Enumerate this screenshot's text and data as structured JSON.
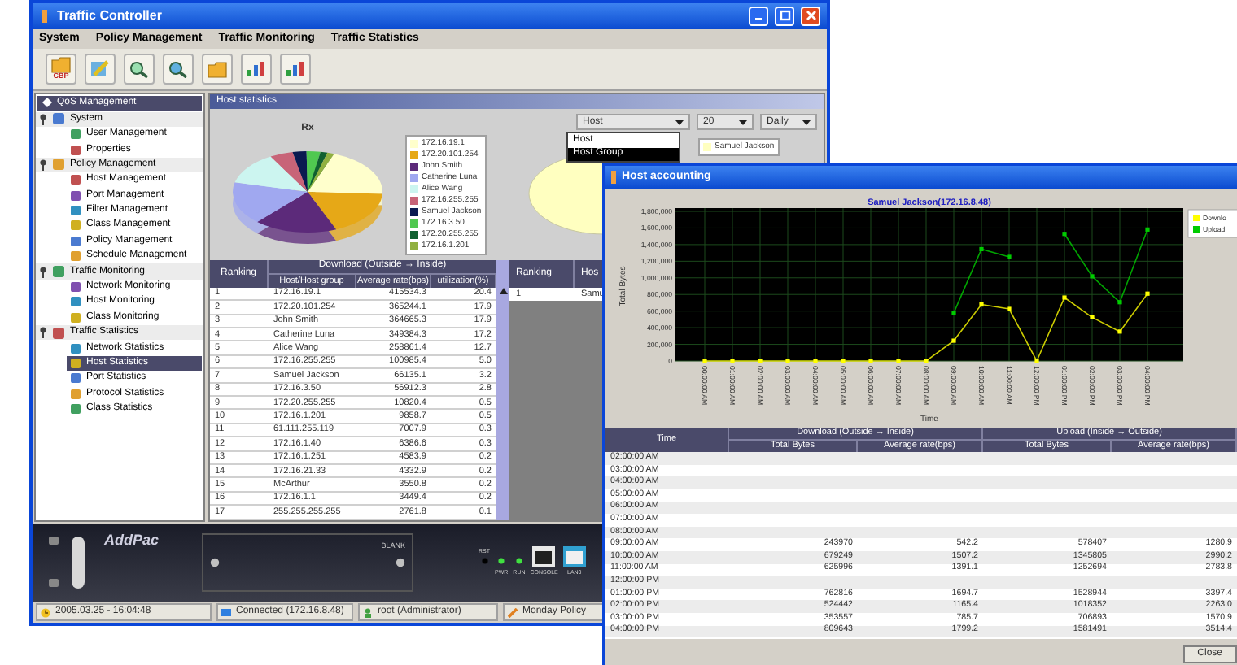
{
  "main_window": {
    "title": "Traffic Controller",
    "menu": [
      "System",
      "Policy Management",
      "Traffic Monitoring",
      "Traffic Statistics"
    ],
    "toolbar": {
      "first_icon_label": "CBP"
    }
  },
  "sidebar": {
    "header": "QoS Management",
    "groups": [
      {
        "label": "System",
        "expanded": true,
        "children": [
          {
            "label": "User Management",
            "selected": false
          },
          {
            "label": "Properties",
            "selected": false
          }
        ]
      },
      {
        "label": "Policy Management",
        "expanded": true,
        "children": [
          {
            "label": "Host Management",
            "selected": false
          },
          {
            "label": "Port Management",
            "selected": false
          },
          {
            "label": "Filter Management",
            "selected": false
          },
          {
            "label": "Class Management",
            "selected": false
          },
          {
            "label": "Policy Management",
            "selected": false
          },
          {
            "label": "Schedule Management",
            "selected": false
          }
        ]
      },
      {
        "label": "Traffic Monitoring",
        "expanded": true,
        "children": [
          {
            "label": "Network Monitoring",
            "selected": false
          },
          {
            "label": "Host Monitoring",
            "selected": false
          },
          {
            "label": "Class Monitoring",
            "selected": false
          }
        ]
      },
      {
        "label": "Traffic Statistics",
        "expanded": true,
        "children": [
          {
            "label": "Network Statistics",
            "selected": false
          },
          {
            "label": "Host Statistics",
            "selected": true
          },
          {
            "label": "Port Statistics",
            "selected": false
          },
          {
            "label": "Protocol Statistics",
            "selected": false
          },
          {
            "label": "Class Statistics",
            "selected": false
          }
        ]
      }
    ]
  },
  "panel": {
    "title": "Host statistics",
    "selects": [
      "Host",
      "20",
      "Daily"
    ],
    "dropdown": [
      {
        "label": "Host",
        "selected": false
      },
      {
        "label": "Host Group",
        "selected": true
      }
    ],
    "pie_left": {
      "title": "Rx",
      "legend": [
        {
          "label": "172.16.19.1",
          "color": "#ffffcc"
        },
        {
          "label": "172.20.101.254",
          "color": "#e6a817"
        },
        {
          "label": "John Smith",
          "color": "#5c2a7a"
        },
        {
          "label": "Catherine Luna",
          "color": "#a0a8f0"
        },
        {
          "label": "Alice Wang",
          "color": "#ccf5f0"
        },
        {
          "label": "172.16.255.255",
          "color": "#c86478"
        },
        {
          "label": "Samuel Jackson",
          "color": "#0a1a50"
        },
        {
          "label": "172.16.3.50",
          "color": "#50c850"
        },
        {
          "label": "172.20.255.255",
          "color": "#106030"
        },
        {
          "label": "172.16.1.201",
          "color": "#90b040"
        }
      ]
    },
    "pie_right": {
      "legend": [
        {
          "label": "Samuel Jackson",
          "color": "#ffffc0"
        }
      ]
    },
    "table": {
      "group_header": "Download (Outside → Inside)",
      "columns": [
        "Ranking",
        "Host/Host group",
        "Average rate(bps)",
        "utilization(%)"
      ],
      "rows": [
        [
          "1",
          "172.16.19.1",
          "415534.3",
          "20.4"
        ],
        [
          "2",
          "172.20.101.254",
          "365244.1",
          "17.9"
        ],
        [
          "3",
          "John Smith",
          "364665.3",
          "17.9"
        ],
        [
          "4",
          "Catherine Luna",
          "349384.3",
          "17.2"
        ],
        [
          "5",
          "Alice Wang",
          "258861.4",
          "12.7"
        ],
        [
          "6",
          "172.16.255.255",
          "100985.4",
          "5.0"
        ],
        [
          "7",
          "Samuel Jackson",
          "66135.1",
          "3.2"
        ],
        [
          "8",
          "172.16.3.50",
          "56912.3",
          "2.8"
        ],
        [
          "9",
          "172.20.255.255",
          "10820.4",
          "0.5"
        ],
        [
          "10",
          "172.16.1.201",
          "9858.7",
          "0.5"
        ],
        [
          "11",
          "61.111.255.119",
          "7007.9",
          "0.3"
        ],
        [
          "12",
          "172.16.1.40",
          "6386.6",
          "0.3"
        ],
        [
          "13",
          "172.16.1.251",
          "4583.9",
          "0.2"
        ],
        [
          "14",
          "172.16.21.33",
          "4332.9",
          "0.2"
        ],
        [
          "15",
          "McArthur",
          "3550.8",
          "0.2"
        ],
        [
          "16",
          "172.16.1.1",
          "3449.4",
          "0.2"
        ],
        [
          "17",
          "255.255.255.255",
          "2761.8",
          "0.1"
        ]
      ]
    },
    "table_right": {
      "columns": [
        "Ranking",
        "Hos"
      ],
      "rows": [
        [
          "1",
          "Samu"
        ]
      ]
    }
  },
  "device": {
    "brand": "AddPac",
    "slot": "BLANK",
    "reset": "RST",
    "leds": [
      "PWR",
      "RUN"
    ],
    "ports": [
      "CONSOLE",
      "LAN0"
    ]
  },
  "status_bar": [
    "2005.03.25 - 16:04:48",
    "Connected (172.16.8.48)",
    "root (Administrator)",
    "Monday Policy"
  ],
  "accounting_window": {
    "title": "Host accounting",
    "chart_data": {
      "type": "line",
      "title": "Samuel Jackson(172.16.8.48)",
      "xlabel": "Time",
      "ylabel": "Total Bytes",
      "categories": [
        "00:00:00 AM",
        "01:00:00 AM",
        "02:00:00 AM",
        "03:00:00 AM",
        "04:00:00 AM",
        "05:00:00 AM",
        "06:00:00 AM",
        "07:00:00 AM",
        "08:00:00 AM",
        "09:00:00 AM",
        "10:00:00 AM",
        "11:00:00 AM",
        "12:00:00 PM",
        "01:00:00 PM",
        "02:00:00 PM",
        "03:00:00 PM",
        "04:00:00 PM"
      ],
      "series": [
        {
          "name": "Downlo",
          "color": "#ffff00",
          "marker": "square",
          "values": [
            0,
            0,
            0,
            0,
            0,
            0,
            0,
            0,
            0,
            243970,
            679249,
            625996,
            0,
            762816,
            524442,
            353557,
            809643
          ]
        },
        {
          "name": "Upload",
          "color": "#00cc00",
          "marker": "square",
          "values": [
            null,
            null,
            null,
            null,
            null,
            null,
            null,
            null,
            null,
            578407,
            1345805,
            1252694,
            null,
            1528944,
            1018352,
            706893,
            1581491
          ]
        }
      ],
      "ylim": [
        0,
        1800000
      ],
      "grid": true,
      "legend": true,
      "yticks": [
        {
          "value": 0,
          "label": "0"
        },
        {
          "value": 200000,
          "label": "200,000"
        },
        {
          "value": 400000,
          "label": "400,000"
        },
        {
          "value": 600000,
          "label": "600,000"
        },
        {
          "value": 800000,
          "label": "800,000"
        },
        {
          "value": 1000000,
          "label": "1,000,000"
        },
        {
          "value": 1200000,
          "label": "1,200,000"
        },
        {
          "value": 1400000,
          "label": "1,400,000"
        },
        {
          "value": 1600000,
          "label": "1,600,000"
        },
        {
          "value": 1800000,
          "label": "1,800,000"
        }
      ]
    },
    "table": {
      "time_header": "Time",
      "groups": [
        "Download (Outside → Inside)",
        "Upload (Inside → Outside)"
      ],
      "sub_columns": [
        "Total Bytes",
        "Average rate(bps)",
        "Total Bytes",
        "Average rate(bps)"
      ],
      "rows": [
        {
          "time": "02:00:00 AM"
        },
        {
          "time": "03:00:00 AM"
        },
        {
          "time": "04:00:00 AM"
        },
        {
          "time": "05:00:00 AM"
        },
        {
          "time": "06:00:00 AM"
        },
        {
          "time": "07:00:00 AM"
        },
        {
          "time": "08:00:00 AM"
        },
        {
          "time": "09:00:00 AM",
          "values": [
            "243970",
            "542.2",
            "578407",
            "1280.9"
          ]
        },
        {
          "time": "10:00:00 AM",
          "values": [
            "679249",
            "1507.2",
            "1345805",
            "2990.2"
          ]
        },
        {
          "time": "11:00:00 AM",
          "values": [
            "625996",
            "1391.1",
            "1252694",
            "2783.8"
          ]
        },
        {
          "time": "12:00:00 PM"
        },
        {
          "time": "01:00:00 PM",
          "values": [
            "762816",
            "1694.7",
            "1528944",
            "3397.4"
          ]
        },
        {
          "time": "02:00:00 PM",
          "values": [
            "524442",
            "1165.4",
            "1018352",
            "2263.0"
          ]
        },
        {
          "time": "03:00:00 PM",
          "values": [
            "353557",
            "785.7",
            "706893",
            "1570.9"
          ]
        },
        {
          "time": "04:00:00 PM",
          "values": [
            "809643",
            "1799.2",
            "1581491",
            "3514.4"
          ]
        }
      ]
    },
    "close_button": "Close"
  }
}
